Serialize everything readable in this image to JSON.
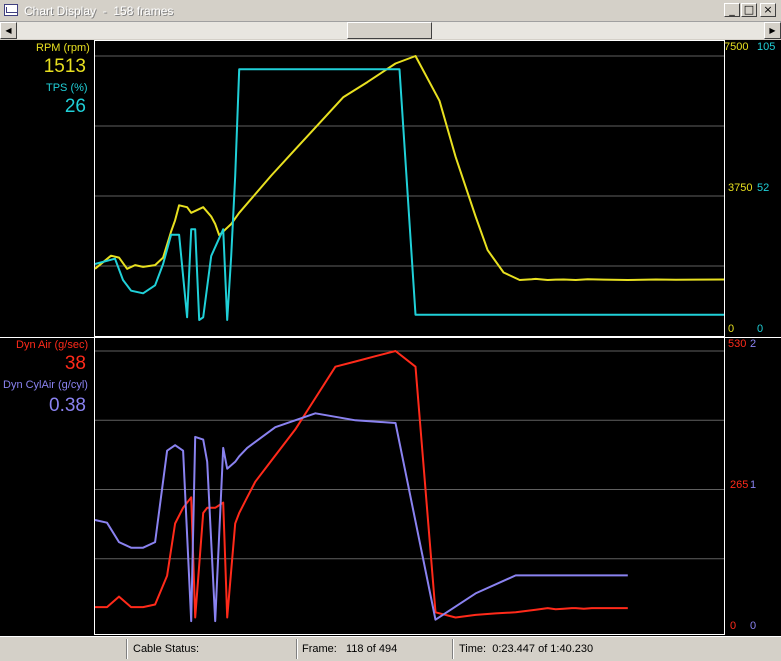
{
  "window": {
    "title": "Chart Display  -  158 frames",
    "buttons": {
      "minimize": "_",
      "maximize": "□",
      "close": "×"
    }
  },
  "colors": {
    "rpm": "#e8e020",
    "tps": "#20d0d8",
    "dyn_air": "#ff2a1a",
    "dyn_cylair": "#8a82f0",
    "grid": "#606060",
    "frame": "#ffffff",
    "background": "#000000"
  },
  "panels": {
    "top": {
      "params": [
        {
          "label": "RPM (rpm)",
          "value": "1513"
        },
        {
          "label": "TPS (%)",
          "value": "26"
        }
      ],
      "axis_left": [
        "7500",
        "3750",
        "0"
      ],
      "axis_right": [
        "105",
        "52",
        "0"
      ]
    },
    "bottom": {
      "params": [
        {
          "label": "Dyn Air (g/sec)",
          "value": "38"
        },
        {
          "label": "Dyn CylAir (g/cyl)",
          "value": "0.38"
        }
      ],
      "axis_left": [
        "530",
        "265",
        "0"
      ],
      "axis_right": [
        "2",
        "1",
        "0"
      ]
    }
  },
  "chart_data": [
    {
      "type": "line",
      "title": "",
      "xlabel": "",
      "ylabel": "",
      "ylim_left": [
        0,
        7500
      ],
      "ylim_right": [
        0,
        105
      ],
      "grid": true,
      "series": [
        {
          "name": "RPM (rpm)",
          "axis": "left",
          "x": [
            0,
            4,
            6,
            8,
            10,
            12,
            15,
            17,
            19,
            20,
            21,
            23,
            24,
            27,
            29,
            30,
            31,
            32,
            34,
            36,
            40,
            44,
            50,
            56,
            62,
            68,
            75,
            80,
            86,
            90,
            95,
            98,
            102,
            106,
            109,
            110,
            111,
            113,
            115,
            117,
            120,
            123,
            127,
            133,
            140,
            145,
            150,
            157
          ],
          "values": [
            1800,
            2150,
            2100,
            1800,
            1900,
            1850,
            1900,
            2100,
            2800,
            3100,
            3500,
            3450,
            3300,
            3450,
            3200,
            3000,
            2700,
            2800,
            3000,
            3300,
            3800,
            4300,
            5000,
            5700,
            6400,
            6800,
            7300,
            7500,
            6300,
            4800,
            3200,
            2300,
            1700,
            1500,
            1520,
            1530,
            1520,
            1500,
            1510,
            1513,
            1500,
            1520,
            1510,
            1500,
            1513,
            1505,
            1510,
            1513
          ]
        },
        {
          "name": "TPS (%)",
          "axis": "right",
          "x": [
            0,
            5,
            7,
            9,
            12,
            15,
            17,
            19,
            21,
            23,
            24,
            25,
            26,
            27,
            29,
            32,
            33,
            34,
            35,
            36,
            37,
            38,
            75,
            76,
            80,
            90,
            100,
            157
          ],
          "values": [
            27,
            29,
            21,
            17,
            16,
            19,
            27,
            38,
            38,
            7,
            40,
            40,
            6,
            7,
            30,
            40,
            6,
            30,
            60,
            100,
            100,
            100,
            100,
            100,
            8,
            8,
            8,
            8
          ]
        }
      ]
    },
    {
      "type": "line",
      "title": "",
      "xlabel": "",
      "ylabel": "",
      "ylim_left": [
        0,
        530
      ],
      "ylim_right": [
        0,
        2
      ],
      "grid": true,
      "series": [
        {
          "name": "Dyn Air (g/sec)",
          "axis": "left",
          "x": [
            0,
            3,
            6,
            9,
            12,
            15,
            18,
            20,
            22,
            24,
            25,
            27,
            28,
            30,
            32,
            33,
            35,
            36,
            38,
            40,
            45,
            50,
            55,
            60,
            65,
            70,
            75,
            80,
            85,
            90,
            95,
            100,
            105,
            110,
            113,
            115,
            117,
            119,
            120,
            122,
            124,
            126,
            128,
            130,
            133
          ],
          "values": [
            40,
            40,
            60,
            40,
            40,
            45,
            100,
            200,
            230,
            250,
            20,
            220,
            230,
            230,
            240,
            20,
            200,
            220,
            250,
            280,
            330,
            380,
            440,
            500,
            510,
            520,
            530,
            500,
            30,
            20,
            25,
            28,
            30,
            35,
            38,
            36,
            37,
            38,
            38,
            37,
            38,
            38,
            38,
            38,
            38
          ]
        },
        {
          "name": "Dyn CylAir (g/cyl)",
          "axis": "right",
          "x": [
            0,
            3,
            6,
            9,
            12,
            15,
            18,
            20,
            22,
            24,
            25,
            27,
            28,
            30,
            32,
            33,
            35,
            36,
            38,
            45,
            55,
            65,
            75,
            85,
            95,
            105,
            115,
            125,
            133
          ],
          "values": [
            0.78,
            0.76,
            0.62,
            0.58,
            0.58,
            0.62,
            1.28,
            1.32,
            1.28,
            0.05,
            1.38,
            1.36,
            1.2,
            0.05,
            1.3,
            1.15,
            1.2,
            1.24,
            1.3,
            1.45,
            1.55,
            1.5,
            1.48,
            0.06,
            0.25,
            0.38,
            0.38,
            0.38,
            0.38
          ]
        }
      ]
    }
  ],
  "status_bar": {
    "cable": "Cable Status:",
    "frame": "Frame:   118 of 494",
    "time": "Time:  0:23.447 of 1:40.230"
  }
}
